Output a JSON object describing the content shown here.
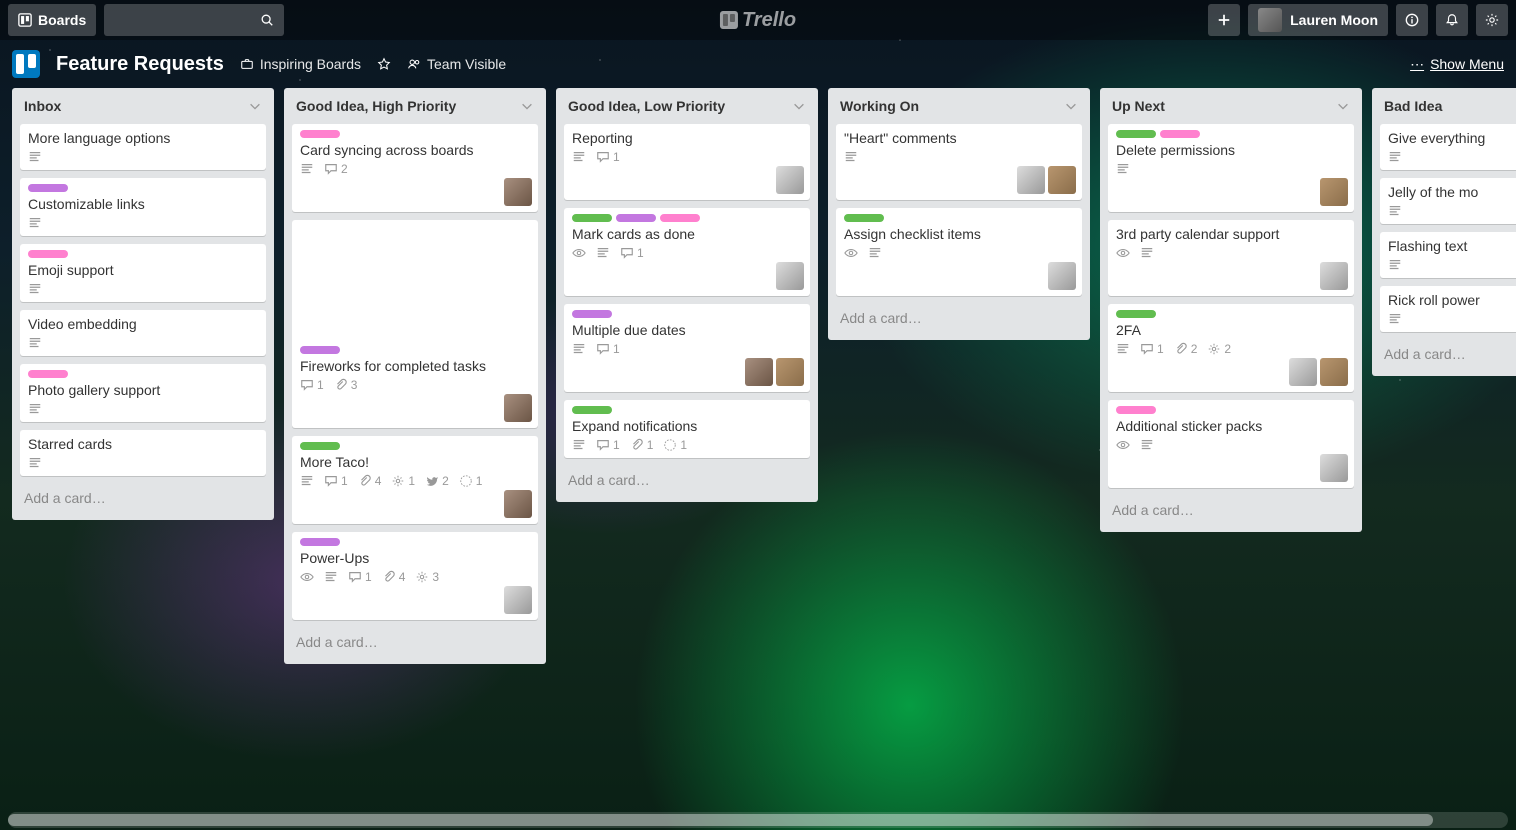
{
  "app": {
    "name": "Trello",
    "boards_btn": "Boards"
  },
  "user": {
    "name": "Lauren Moon"
  },
  "board": {
    "title": "Feature Requests",
    "team": "Inspiring Boards",
    "visibility": "Team Visible",
    "show_menu": "Show Menu",
    "add_card": "Add a card…"
  },
  "colors": {
    "green": "#61BD4F",
    "purple": "#C377E0",
    "pink": "#FF80CE"
  },
  "lists": [
    {
      "title": "Inbox",
      "cards": [
        {
          "title": "More language options",
          "badges": {
            "desc": true
          }
        },
        {
          "title": "Customizable links",
          "labels": [
            "purple"
          ],
          "badges": {
            "desc": true
          }
        },
        {
          "title": "Emoji support",
          "labels": [
            "pink"
          ],
          "badges": {
            "desc": true
          }
        },
        {
          "title": "Video embedding",
          "badges": {
            "desc": true
          }
        },
        {
          "title": "Photo gallery support",
          "labels": [
            "pink"
          ],
          "badges": {
            "desc": true
          }
        },
        {
          "title": "Starred cards",
          "badges": {
            "desc": true
          }
        }
      ]
    },
    {
      "title": "Good Idea, High Priority",
      "cards": [
        {
          "title": "Card syncing across boards",
          "labels": [
            "pink"
          ],
          "badges": {
            "desc": true,
            "comments": 2
          },
          "members": [
            "m1"
          ]
        },
        {
          "title": "Fireworks for completed tasks",
          "labels": [
            "purple"
          ],
          "cover": true,
          "badges": {
            "comments": 1,
            "attachments": 3
          },
          "members": [
            "m1"
          ]
        },
        {
          "title": "More Taco!",
          "labels": [
            "green"
          ],
          "badges": {
            "desc": true,
            "comments": 1,
            "attachments": 4,
            "gear": 1,
            "twitter": 2,
            "votes": 1
          },
          "members": [
            "m1"
          ]
        },
        {
          "title": "Power-Ups",
          "labels": [
            "purple"
          ],
          "badges": {
            "eye": true,
            "desc": true,
            "comments": 1,
            "attachments": 4,
            "gear": 3
          },
          "members": [
            "m2"
          ]
        }
      ]
    },
    {
      "title": "Good Idea, Low Priority",
      "cards": [
        {
          "title": "Reporting",
          "badges": {
            "desc": true,
            "comments": 1
          },
          "members": [
            "m2"
          ]
        },
        {
          "title": "Mark cards as done",
          "labels": [
            "green",
            "purple",
            "pink"
          ],
          "badges": {
            "eye": true,
            "desc": true,
            "comments": 1
          },
          "members": [
            "m2"
          ]
        },
        {
          "title": "Multiple due dates",
          "labels": [
            "purple"
          ],
          "badges": {
            "desc": true,
            "comments": 1
          },
          "members": [
            "m1",
            "m3"
          ]
        },
        {
          "title": "Expand notifications",
          "labels": [
            "green"
          ],
          "badges": {
            "desc": true,
            "comments": 1,
            "attachments": 1,
            "votes": 1
          }
        }
      ]
    },
    {
      "title": "Working On",
      "cards": [
        {
          "title": "\"Heart\" comments",
          "badges": {
            "desc": true
          },
          "members": [
            "m2",
            "m3"
          ]
        },
        {
          "title": "Assign checklist items",
          "labels": [
            "green"
          ],
          "badges": {
            "eye": true,
            "desc": true
          },
          "members": [
            "m2"
          ]
        }
      ]
    },
    {
      "title": "Up Next",
      "cards": [
        {
          "title": "Delete permissions",
          "labels": [
            "green",
            "pink"
          ],
          "badges": {
            "desc": true
          },
          "members": [
            "m3"
          ]
        },
        {
          "title": "3rd party calendar support",
          "badges": {
            "eye": true,
            "desc": true
          },
          "members": [
            "m2"
          ]
        },
        {
          "title": "2FA",
          "labels": [
            "green"
          ],
          "badges": {
            "desc": true,
            "comments": 1,
            "attachments": 2,
            "gear": 2
          },
          "members": [
            "m2",
            "m3"
          ]
        },
        {
          "title": "Additional sticker packs",
          "labels": [
            "pink"
          ],
          "badges": {
            "eye": true,
            "desc": true
          },
          "members": [
            "m2"
          ]
        }
      ]
    },
    {
      "title": "Bad Idea",
      "cards": [
        {
          "title": "Give everything",
          "badges": {
            "desc": true
          }
        },
        {
          "title": "Jelly of the mo",
          "badges": {
            "desc": true
          }
        },
        {
          "title": "Flashing text",
          "badges": {
            "desc": true
          }
        },
        {
          "title": "Rick roll power",
          "badges": {
            "desc": true
          }
        }
      ]
    }
  ]
}
